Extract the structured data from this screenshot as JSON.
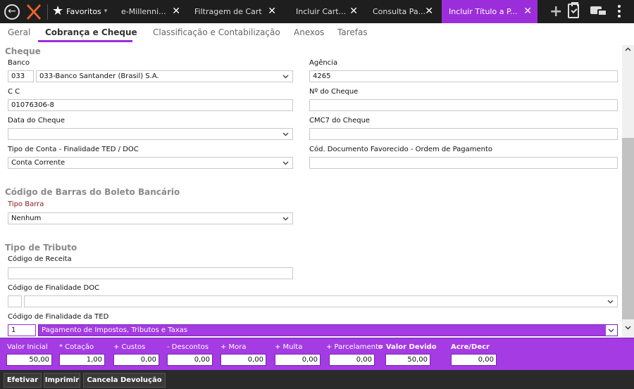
{
  "topbar": {
    "favorites_label": "Favoritos",
    "tabs": [
      {
        "label": "e-Millenni..."
      },
      {
        "label": "Filtragem de Cart..."
      },
      {
        "label": "Incluir Cart..."
      },
      {
        "label": "Consulta Pa..."
      },
      {
        "label": "Incluir Título a P..."
      }
    ],
    "active_tab_index": 4,
    "accent_color": "#9b2ddb"
  },
  "subtabs": [
    {
      "label": "Geral"
    },
    {
      "label": "Cobrança e Cheque"
    },
    {
      "label": "Classificação e Contabilização"
    },
    {
      "label": "Anexos"
    },
    {
      "label": "Tarefas"
    }
  ],
  "cheque": {
    "section_title": "Cheque",
    "banco_label": "Banco",
    "banco_code": "033",
    "banco_name": "033-Banco Santander (Brasil) S.A.",
    "agencia_label": "Agência",
    "agencia_value": "4265",
    "cc_label": "C C",
    "cc_value": "01076306-8",
    "num_cheque_label": "Nº do Cheque",
    "num_cheque_value": "",
    "data_label": "Data do Cheque",
    "data_value": "",
    "cmc7_label": "CMC7 do Cheque",
    "cmc7_value": "",
    "tipo_conta_label": "Tipo de Conta - Finalidade TED / DOC",
    "tipo_conta_value": "Conta Corrente",
    "cod_doc_label": "Cód. Documento Favorecido - Ordem de Pagamento",
    "cod_doc_value": ""
  },
  "boleto": {
    "section_title": "Código de Barras do Boleto Bancário",
    "tipo_barra_label": "Tipo Barra",
    "tipo_barra_value": "Nenhum"
  },
  "tributo": {
    "section_title": "Tipo de Tributo",
    "cod_receita_label": "Código de Receita",
    "cod_receita_value": "",
    "finalidade_doc_label": "Código de Finalidade DOC",
    "finalidade_doc_code": "",
    "finalidade_doc_value": "",
    "finalidade_ted_label": "Código de Finalidade da TED",
    "finalidade_ted_code": "1",
    "finalidade_ted_value": "Pagamento de Impostos, Tributos e Taxas"
  },
  "totals": [
    {
      "label": "Valor Inicial",
      "value": "50,00"
    },
    {
      "label": "* Cotação",
      "value": "1,00"
    },
    {
      "label": "+ Custos",
      "value": "0,00"
    },
    {
      "label": "- Descontos",
      "value": "0,00"
    },
    {
      "label": "+ Mora",
      "value": "0,00"
    },
    {
      "label": "+ Multa",
      "value": "0,00"
    },
    {
      "label": "+ Parcelamento",
      "value": "0,00"
    },
    {
      "label": "= Valor Devido",
      "value": "50,00"
    },
    {
      "label": "Acre/Decr",
      "value": "0,00"
    }
  ],
  "buttons": {
    "efetivar": "Efetivar",
    "imprimir": "Imprimir",
    "cancela": "Cancela Devolução"
  }
}
